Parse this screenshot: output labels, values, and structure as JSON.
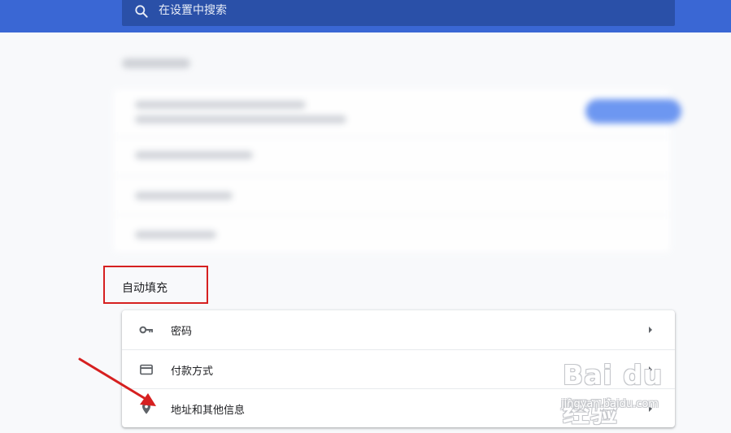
{
  "search": {
    "placeholder": "在设置中搜索",
    "value": ""
  },
  "autofill": {
    "title": "自动填充",
    "items": [
      {
        "label": "密码",
        "icon": "key-icon"
      },
      {
        "label": "付款方式",
        "icon": "credit-card-icon"
      },
      {
        "label": "地址和其他信息",
        "icon": "location-pin-icon"
      }
    ]
  },
  "watermark": {
    "logo_text": "Bai du 经验",
    "url": "jingyan.baidu.com"
  },
  "colors": {
    "header": "#3a67d4",
    "search_bg": "#2a50a8",
    "highlight_box": "#d62020",
    "annotation_arrow": "#d62020"
  }
}
